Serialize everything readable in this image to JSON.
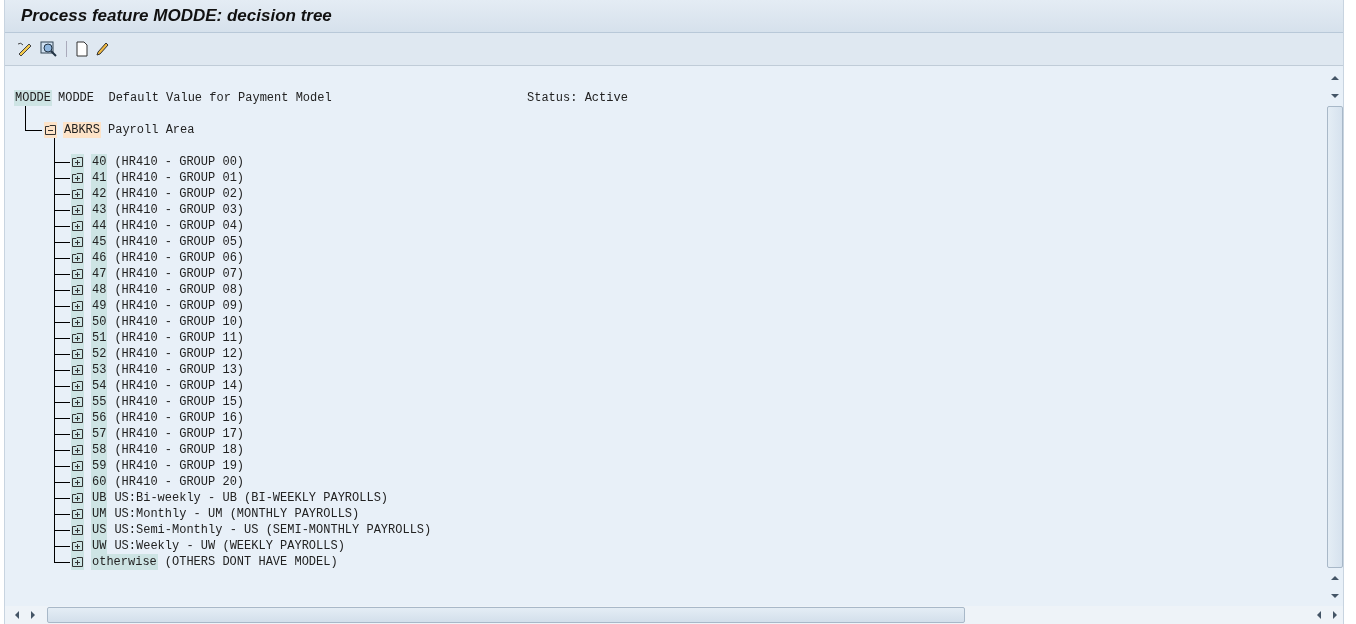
{
  "window": {
    "title": "Process feature MODDE: decision tree"
  },
  "tree": {
    "key": "MODDE",
    "description": "MODDE  Default Value for Payment Model",
    "status": "Status: Active",
    "children": [
      {
        "key": "ABKRS",
        "text": "Payroll Area",
        "expanded": true,
        "children": [
          {
            "key": "40",
            "text": "(HR410 - GROUP 00)",
            "expanded": false
          },
          {
            "key": "41",
            "text": "(HR410 - GROUP 01)",
            "expanded": false
          },
          {
            "key": "42",
            "text": "(HR410 - GROUP 02)",
            "expanded": false
          },
          {
            "key": "43",
            "text": "(HR410 - GROUP 03)",
            "expanded": false
          },
          {
            "key": "44",
            "text": "(HR410 - GROUP 04)",
            "expanded": false
          },
          {
            "key": "45",
            "text": "(HR410 - GROUP 05)",
            "expanded": false
          },
          {
            "key": "46",
            "text": "(HR410 - GROUP 06)",
            "expanded": false
          },
          {
            "key": "47",
            "text": "(HR410 - GROUP 07)",
            "expanded": false
          },
          {
            "key": "48",
            "text": "(HR410 - GROUP 08)",
            "expanded": false
          },
          {
            "key": "49",
            "text": "(HR410 - GROUP 09)",
            "expanded": false
          },
          {
            "key": "50",
            "text": "(HR410 - GROUP 10)",
            "expanded": false
          },
          {
            "key": "51",
            "text": "(HR410 - GROUP 11)",
            "expanded": false
          },
          {
            "key": "52",
            "text": "(HR410 - GROUP 12)",
            "expanded": false
          },
          {
            "key": "53",
            "text": "(HR410 - GROUP 13)",
            "expanded": false
          },
          {
            "key": "54",
            "text": "(HR410 - GROUP 14)",
            "expanded": false
          },
          {
            "key": "55",
            "text": "(HR410 - GROUP 15)",
            "expanded": false
          },
          {
            "key": "56",
            "text": "(HR410 - GROUP 16)",
            "expanded": false
          },
          {
            "key": "57",
            "text": "(HR410 - GROUP 17)",
            "expanded": false
          },
          {
            "key": "58",
            "text": "(HR410 - GROUP 18)",
            "expanded": false
          },
          {
            "key": "59",
            "text": "(HR410 - GROUP 19)",
            "expanded": false
          },
          {
            "key": "60",
            "text": "(HR410 - GROUP 20)",
            "expanded": false
          },
          {
            "key": "UB",
            "text": "US:Bi-weekly - UB (BI-WEEKLY PAYROLLS)",
            "expanded": false
          },
          {
            "key": "UM",
            "text": "US:Monthly - UM (MONTHLY PAYROLLS)",
            "expanded": false
          },
          {
            "key": "US",
            "text": "US:Semi-Monthly - US (SEMI-MONTHLY PAYROLLS)",
            "expanded": false
          },
          {
            "key": "UW",
            "text": "US:Weekly - UW (WEEKLY PAYROLLS)",
            "expanded": false
          },
          {
            "key": "otherwise",
            "text": "(OTHERS DONT HAVE MODEL)",
            "expanded": false
          }
        ]
      }
    ]
  }
}
